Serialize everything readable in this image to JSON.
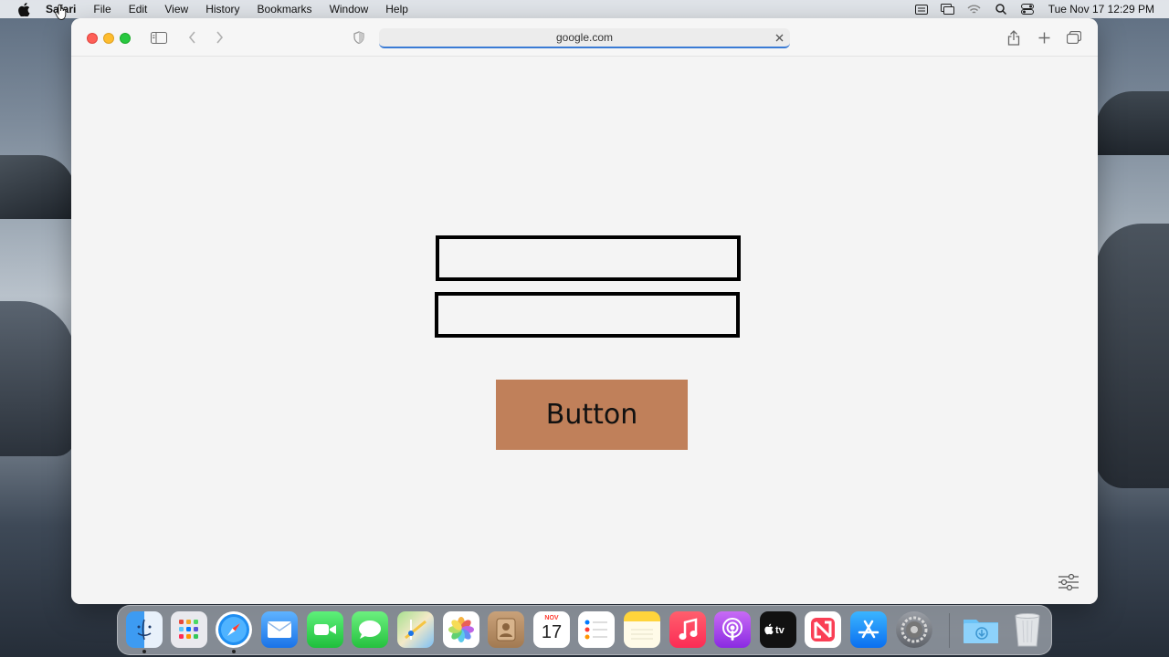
{
  "menubar": {
    "app_name": "Safari",
    "items": [
      "File",
      "Edit",
      "View",
      "History",
      "Bookmarks",
      "Window",
      "Help"
    ],
    "clock": "Tue Nov 17  12:29 PM"
  },
  "browser": {
    "url": "google.com"
  },
  "page": {
    "button_label": "Button"
  },
  "dock": {
    "calendar_month": "NOV",
    "calendar_day": "17",
    "apps": [
      "finder",
      "launchpad",
      "safari",
      "mail",
      "facetime",
      "messages",
      "maps",
      "photos",
      "contacts",
      "calendar",
      "reminders",
      "notes",
      "music",
      "podcasts",
      "tv",
      "news",
      "app-store",
      "system-preferences",
      "downloads",
      "trash"
    ]
  },
  "colors": {
    "button_bg": "#c0805a",
    "url_focus": "#3a7bd5"
  }
}
